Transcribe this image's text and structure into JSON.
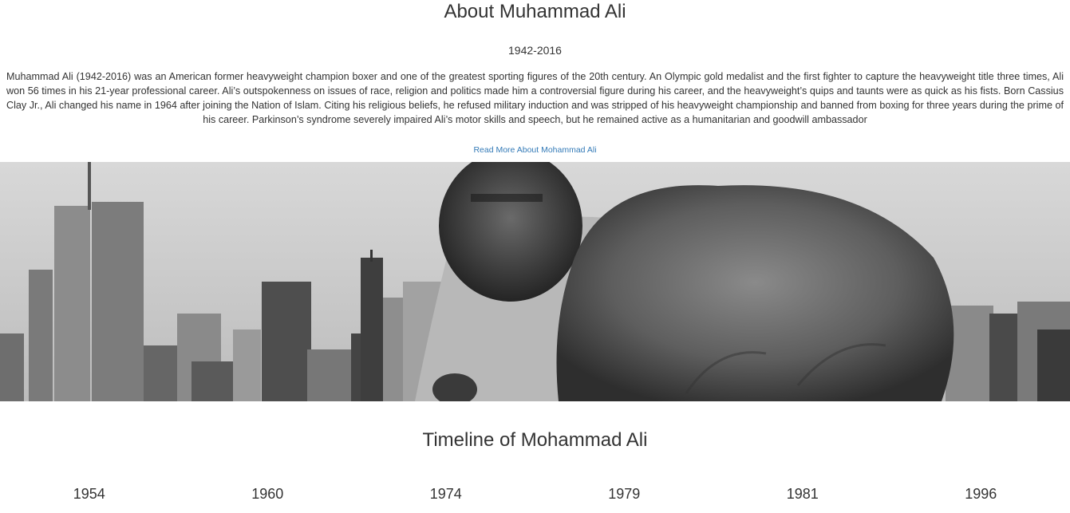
{
  "about": {
    "title": "About Muhammad Ali",
    "dates": "1942-2016",
    "bio": "Muhammad Ali (1942-2016) was an American former heavyweight champion boxer and one of the greatest sporting figures of the 20th century. An Olympic gold medalist and the first fighter to capture the heavyweight title three times, Ali won 56 times in his 21-year professional career. Ali’s outspokenness on issues of race, religion and politics made him a controversial figure during his career, and the heavyweight’s quips and taunts were as quick as his fists. Born Cassius Clay Jr., Ali changed his name in 1964 after joining the Nation of Islam. Citing his religious beliefs, he refused military induction and was stripped of his heavyweight championship and banned from boxing for three years during the prime of his career. Parkinson’s syndrome severely impaired Ali’s motor skills and speech, but he remained active as a humanitarian and goodwill ambassador",
    "read_more": "Read More About Mohammad Ali"
  },
  "banner": {
    "description_icon": "photo-boxer-fist-city-skyline"
  },
  "timeline": {
    "title": "Timeline of Mohammad Ali",
    "years": [
      "1954",
      "1960",
      "1974",
      "1979",
      "1981",
      "1996"
    ]
  },
  "colors": {
    "text": "#333333",
    "link": "#337ab7",
    "background": "#ffffff"
  }
}
